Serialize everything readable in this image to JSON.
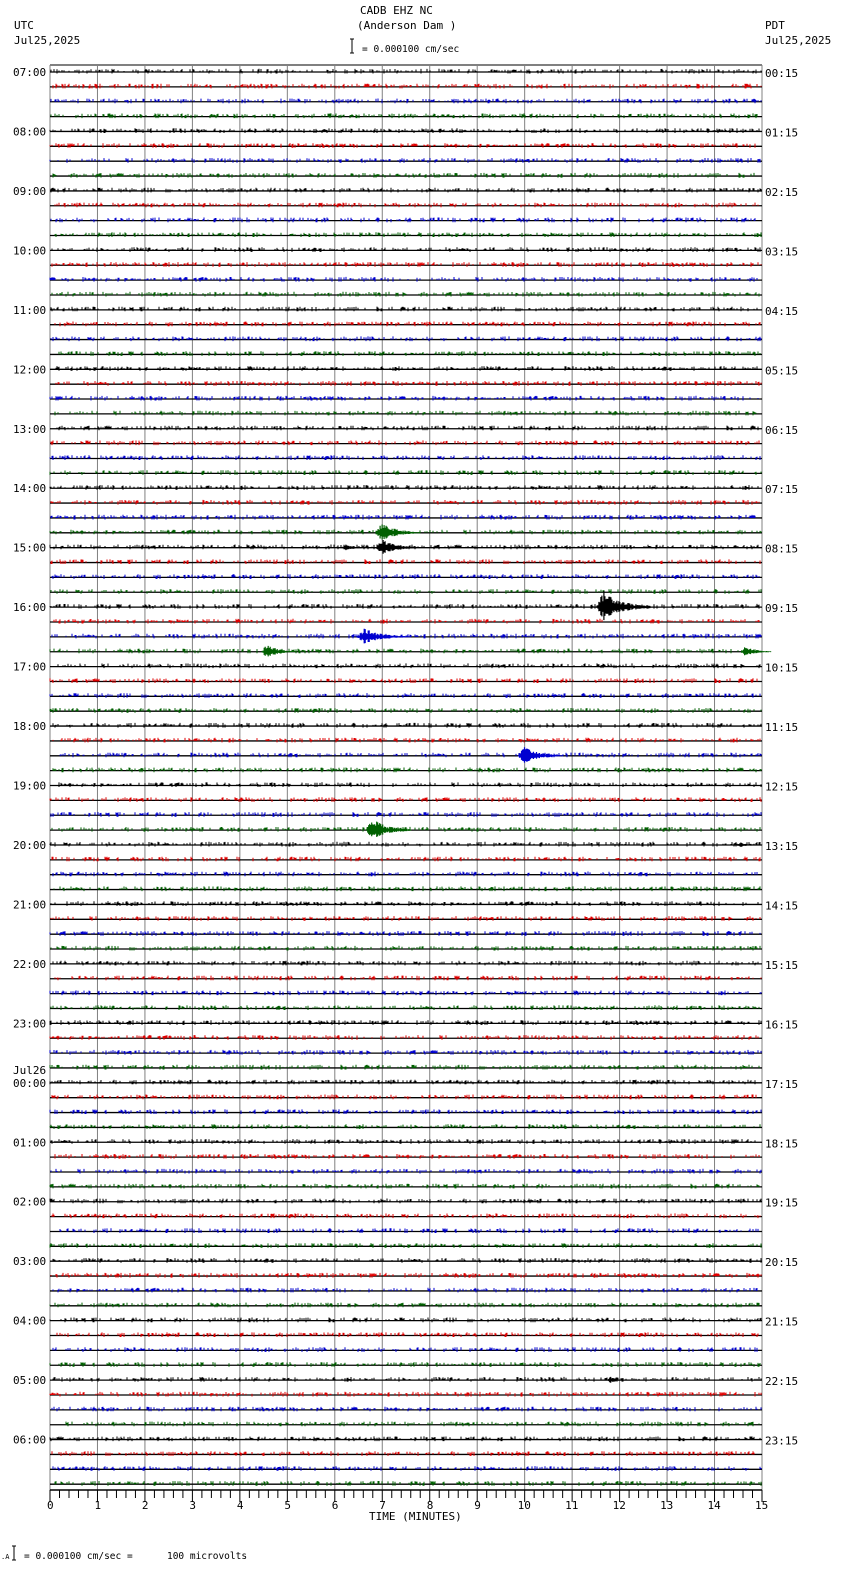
{
  "header": {
    "title": "CADB EHZ NC",
    "subtitle": "(Anderson Dam )",
    "scale_text": "= 0.000100 cm/sec",
    "left_tz": "UTC",
    "left_date": "Jul25,2025",
    "right_tz": "PDT",
    "right_date": "Jul25,2025"
  },
  "footer": {
    "scale_text": "= 0.000100 cm/sec =      100 microvolts"
  },
  "chart_data": {
    "type": "line",
    "title": "CADB EHZ NC (Anderson Dam )",
    "xlabel": "TIME (MINUTES)",
    "xlim": [
      0,
      15
    ],
    "x_ticks": [
      0,
      1,
      2,
      3,
      4,
      5,
      6,
      7,
      8,
      9,
      10,
      11,
      12,
      13,
      14,
      15
    ],
    "minutes_per_trace": 15,
    "trace_colors": [
      "#000000",
      "#e00000",
      "#0000d0",
      "#006000"
    ],
    "utc_labels": [
      "07:00",
      "08:00",
      "09:00",
      "10:00",
      "11:00",
      "12:00",
      "13:00",
      "14:00",
      "15:00",
      "16:00",
      "17:00",
      "18:00",
      "19:00",
      "20:00",
      "21:00",
      "22:00",
      "23:00",
      "00:00",
      "01:00",
      "02:00",
      "03:00",
      "04:00",
      "05:00",
      "06:00"
    ],
    "date_change": {
      "before": "00:00",
      "label": "Jul26"
    },
    "pdt_labels": [
      "00:15",
      "01:15",
      "02:15",
      "03:15",
      "04:15",
      "05:15",
      "06:15",
      "07:15",
      "08:15",
      "09:15",
      "10:15",
      "11:15",
      "12:15",
      "13:15",
      "14:15",
      "15:15",
      "16:15",
      "17:15",
      "18:15",
      "19:15",
      "20:15",
      "21:15",
      "22:15",
      "23:15"
    ],
    "events": [
      {
        "utc": "14:45",
        "minute": 7.0,
        "amplitude": 0.8,
        "duration": 0.8
      },
      {
        "utc": "15:00",
        "minute": 6.3,
        "amplitude": 0.3,
        "duration": 0.4
      },
      {
        "utc": "15:00",
        "minute": 7.0,
        "amplitude": 0.7,
        "duration": 0.8
      },
      {
        "utc": "16:00",
        "minute": 11.65,
        "amplitude": 1.4,
        "duration": 1.0
      },
      {
        "utc": "16:30",
        "minute": 6.6,
        "amplitude": 0.7,
        "duration": 1.0
      },
      {
        "utc": "16:45",
        "minute": 4.6,
        "amplitude": 0.6,
        "duration": 0.6
      },
      {
        "utc": "16:45",
        "minute": 14.7,
        "amplitude": 0.5,
        "duration": 0.5
      },
      {
        "utc": "18:30",
        "minute": 10.0,
        "amplitude": 0.8,
        "duration": 0.8
      },
      {
        "utc": "19:45",
        "minute": 6.8,
        "amplitude": 1.0,
        "duration": 0.8
      },
      {
        "utc": "20:00",
        "minute": 14.6,
        "amplitude": 0.25,
        "duration": 0.4
      },
      {
        "utc": "05:00",
        "minute": 11.9,
        "amplitude": 0.3,
        "duration": 0.2
      }
    ]
  }
}
